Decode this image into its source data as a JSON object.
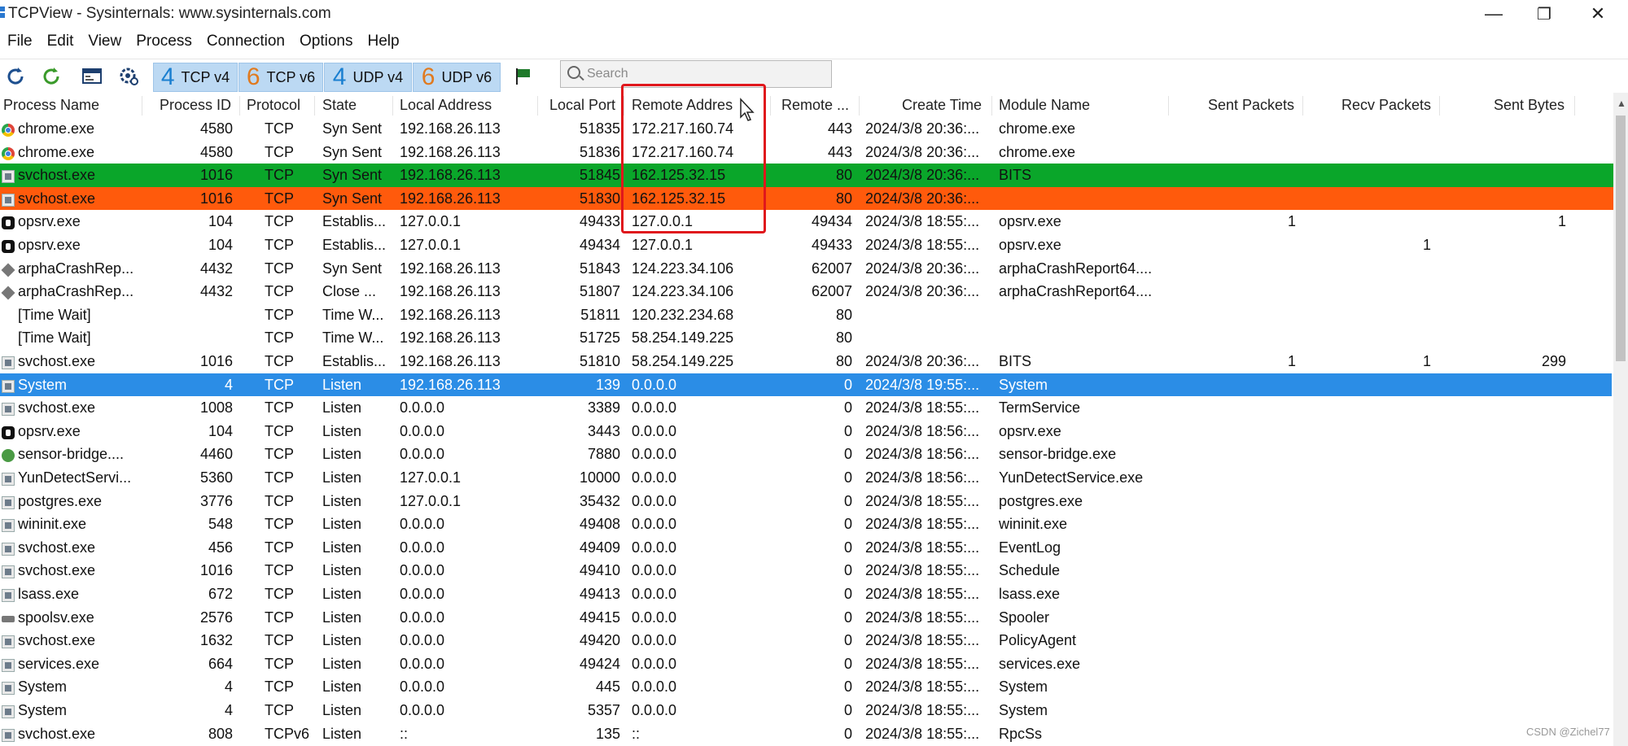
{
  "window": {
    "title": "TCPView - Sysinternals: www.sysinternals.com",
    "minimize_glyph": "—",
    "maximize_glyph": "❐",
    "close_glyph": "✕"
  },
  "menu": [
    "File",
    "Edit",
    "View",
    "Process",
    "Connection",
    "Options",
    "Help"
  ],
  "toolbar": {
    "refresh_icon": "refresh-icon",
    "auto_refresh_icon": "auto-refresh-icon",
    "protocols": [
      {
        "digit": "4",
        "label": "TCP v4"
      },
      {
        "digit": "6",
        "label": "TCP v6"
      },
      {
        "digit": "4",
        "label": "UDP v4"
      },
      {
        "digit": "6",
        "label": "UDP v6"
      }
    ],
    "search_placeholder": "Search"
  },
  "columns": [
    "Process Name",
    "Process ID",
    "Protocol",
    "State",
    "Local Address",
    "Local Port",
    "Remote Addres",
    "Remote ...",
    "Create Time",
    "Module Name",
    "Sent Packets",
    "Recv Packets",
    "Sent Bytes"
  ],
  "rows": [
    {
      "icon": "chrome",
      "name": "chrome.exe",
      "pid": "4580",
      "proto": "TCP",
      "state": "Syn Sent",
      "laddr": "192.168.26.113",
      "lport": "51835",
      "raddr": "172.217.160.74",
      "rport": "443",
      "ctime": "2024/3/8 20:36:...",
      "module": "chrome.exe",
      "sp": "",
      "rp": "",
      "sb": "",
      "style": ""
    },
    {
      "icon": "chrome",
      "name": "chrome.exe",
      "pid": "4580",
      "proto": "TCP",
      "state": "Syn Sent",
      "laddr": "192.168.26.113",
      "lport": "51836",
      "raddr": "172.217.160.74",
      "rport": "443",
      "ctime": "2024/3/8 20:36:...",
      "module": "chrome.exe",
      "sp": "",
      "rp": "",
      "sb": "",
      "style": ""
    },
    {
      "icon": "svc",
      "name": "svchost.exe",
      "pid": "1016",
      "proto": "TCP",
      "state": "Syn Sent",
      "laddr": "192.168.26.113",
      "lport": "51845",
      "raddr": "162.125.32.15",
      "rport": "80",
      "ctime": "2024/3/8 20:36:...",
      "module": "BITS",
      "sp": "",
      "rp": "",
      "sb": "",
      "style": "green"
    },
    {
      "icon": "svc",
      "name": "svchost.exe",
      "pid": "1016",
      "proto": "TCP",
      "state": "Syn Sent",
      "laddr": "192.168.26.113",
      "lport": "51830",
      "raddr": "162.125.32.15",
      "rport": "80",
      "ctime": "2024/3/8 20:36:...",
      "module": "",
      "sp": "",
      "rp": "",
      "sb": "",
      "style": "orange"
    },
    {
      "icon": "black",
      "name": "opsrv.exe",
      "pid": "104",
      "proto": "TCP",
      "state": "Establis...",
      "laddr": "127.0.0.1",
      "lport": "49433",
      "raddr": "127.0.0.1",
      "rport": "49434",
      "ctime": "2024/3/8 18:55:...",
      "module": "opsrv.exe",
      "sp": "1",
      "rp": "",
      "sb": "1",
      "style": ""
    },
    {
      "icon": "black",
      "name": "opsrv.exe",
      "pid": "104",
      "proto": "TCP",
      "state": "Establis...",
      "laddr": "127.0.0.1",
      "lport": "49434",
      "raddr": "127.0.0.1",
      "rport": "49433",
      "ctime": "2024/3/8 18:55:...",
      "module": "opsrv.exe",
      "sp": "",
      "rp": "1",
      "sb": "",
      "style": ""
    },
    {
      "icon": "arpha",
      "name": "arphaCrashRep...",
      "pid": "4432",
      "proto": "TCP",
      "state": "Syn Sent",
      "laddr": "192.168.26.113",
      "lport": "51843",
      "raddr": "124.223.34.106",
      "rport": "62007",
      "ctime": "2024/3/8 20:36:...",
      "module": "arphaCrashReport64....",
      "sp": "",
      "rp": "",
      "sb": "",
      "style": ""
    },
    {
      "icon": "arpha",
      "name": "arphaCrashRep...",
      "pid": "4432",
      "proto": "TCP",
      "state": "Close ...",
      "laddr": "192.168.26.113",
      "lport": "51807",
      "raddr": "124.223.34.106",
      "rport": "62007",
      "ctime": "2024/3/8 20:36:...",
      "module": "arphaCrashReport64....",
      "sp": "",
      "rp": "",
      "sb": "",
      "style": ""
    },
    {
      "icon": "none",
      "name": "[Time Wait]",
      "pid": "",
      "proto": "TCP",
      "state": "Time W...",
      "laddr": "192.168.26.113",
      "lport": "51811",
      "raddr": "120.232.234.68",
      "rport": "80",
      "ctime": "",
      "module": "",
      "sp": "",
      "rp": "",
      "sb": "",
      "style": ""
    },
    {
      "icon": "none",
      "name": "[Time Wait]",
      "pid": "",
      "proto": "TCP",
      "state": "Time W...",
      "laddr": "192.168.26.113",
      "lport": "51725",
      "raddr": "58.254.149.225",
      "rport": "80",
      "ctime": "",
      "module": "",
      "sp": "",
      "rp": "",
      "sb": "",
      "style": ""
    },
    {
      "icon": "svc",
      "name": "svchost.exe",
      "pid": "1016",
      "proto": "TCP",
      "state": "Establis...",
      "laddr": "192.168.26.113",
      "lport": "51810",
      "raddr": "58.254.149.225",
      "rport": "80",
      "ctime": "2024/3/8 20:36:...",
      "module": "BITS",
      "sp": "1",
      "rp": "1",
      "sb": "299",
      "style": ""
    },
    {
      "icon": "svc",
      "name": "System",
      "pid": "4",
      "proto": "TCP",
      "state": "Listen",
      "laddr": "192.168.26.113",
      "lport": "139",
      "raddr": "0.0.0.0",
      "rport": "0",
      "ctime": "2024/3/8 19:55:...",
      "module": "System",
      "sp": "",
      "rp": "",
      "sb": "",
      "style": "selected"
    },
    {
      "icon": "svc",
      "name": "svchost.exe",
      "pid": "1008",
      "proto": "TCP",
      "state": "Listen",
      "laddr": "0.0.0.0",
      "lport": "3389",
      "raddr": "0.0.0.0",
      "rport": "0",
      "ctime": "2024/3/8 18:55:...",
      "module": "TermService",
      "sp": "",
      "rp": "",
      "sb": "",
      "style": ""
    },
    {
      "icon": "black",
      "name": "opsrv.exe",
      "pid": "104",
      "proto": "TCP",
      "state": "Listen",
      "laddr": "0.0.0.0",
      "lport": "3443",
      "raddr": "0.0.0.0",
      "rport": "0",
      "ctime": "2024/3/8 18:56:...",
      "module": "opsrv.exe",
      "sp": "",
      "rp": "",
      "sb": "",
      "style": ""
    },
    {
      "icon": "green",
      "name": "sensor-bridge....",
      "pid": "4460",
      "proto": "TCP",
      "state": "Listen",
      "laddr": "0.0.0.0",
      "lport": "7880",
      "raddr": "0.0.0.0",
      "rport": "0",
      "ctime": "2024/3/8 18:56:...",
      "module": "sensor-bridge.exe",
      "sp": "",
      "rp": "",
      "sb": "",
      "style": ""
    },
    {
      "icon": "svc",
      "name": "YunDetectServi...",
      "pid": "5360",
      "proto": "TCP",
      "state": "Listen",
      "laddr": "127.0.0.1",
      "lport": "10000",
      "raddr": "0.0.0.0",
      "rport": "0",
      "ctime": "2024/3/8 18:56:...",
      "module": "YunDetectService.exe",
      "sp": "",
      "rp": "",
      "sb": "",
      "style": ""
    },
    {
      "icon": "svc",
      "name": "postgres.exe",
      "pid": "3776",
      "proto": "TCP",
      "state": "Listen",
      "laddr": "127.0.0.1",
      "lport": "35432",
      "raddr": "0.0.0.0",
      "rport": "0",
      "ctime": "2024/3/8 18:55:...",
      "module": "postgres.exe",
      "sp": "",
      "rp": "",
      "sb": "",
      "style": ""
    },
    {
      "icon": "svc",
      "name": "wininit.exe",
      "pid": "548",
      "proto": "TCP",
      "state": "Listen",
      "laddr": "0.0.0.0",
      "lport": "49408",
      "raddr": "0.0.0.0",
      "rport": "0",
      "ctime": "2024/3/8 18:55:...",
      "module": "wininit.exe",
      "sp": "",
      "rp": "",
      "sb": "",
      "style": ""
    },
    {
      "icon": "svc",
      "name": "svchost.exe",
      "pid": "456",
      "proto": "TCP",
      "state": "Listen",
      "laddr": "0.0.0.0",
      "lport": "49409",
      "raddr": "0.0.0.0",
      "rport": "0",
      "ctime": "2024/3/8 18:55:...",
      "module": "EventLog",
      "sp": "",
      "rp": "",
      "sb": "",
      "style": ""
    },
    {
      "icon": "svc",
      "name": "svchost.exe",
      "pid": "1016",
      "proto": "TCP",
      "state": "Listen",
      "laddr": "0.0.0.0",
      "lport": "49410",
      "raddr": "0.0.0.0",
      "rport": "0",
      "ctime": "2024/3/8 18:55:...",
      "module": "Schedule",
      "sp": "",
      "rp": "",
      "sb": "",
      "style": ""
    },
    {
      "icon": "svc",
      "name": "lsass.exe",
      "pid": "672",
      "proto": "TCP",
      "state": "Listen",
      "laddr": "0.0.0.0",
      "lport": "49413",
      "raddr": "0.0.0.0",
      "rport": "0",
      "ctime": "2024/3/8 18:55:...",
      "module": "lsass.exe",
      "sp": "",
      "rp": "",
      "sb": "",
      "style": ""
    },
    {
      "icon": "spool",
      "name": "spoolsv.exe",
      "pid": "2576",
      "proto": "TCP",
      "state": "Listen",
      "laddr": "0.0.0.0",
      "lport": "49415",
      "raddr": "0.0.0.0",
      "rport": "0",
      "ctime": "2024/3/8 18:55:...",
      "module": "Spooler",
      "sp": "",
      "rp": "",
      "sb": "",
      "style": ""
    },
    {
      "icon": "svc",
      "name": "svchost.exe",
      "pid": "1632",
      "proto": "TCP",
      "state": "Listen",
      "laddr": "0.0.0.0",
      "lport": "49420",
      "raddr": "0.0.0.0",
      "rport": "0",
      "ctime": "2024/3/8 18:55:...",
      "module": "PolicyAgent",
      "sp": "",
      "rp": "",
      "sb": "",
      "style": ""
    },
    {
      "icon": "svc",
      "name": "services.exe",
      "pid": "664",
      "proto": "TCP",
      "state": "Listen",
      "laddr": "0.0.0.0",
      "lport": "49424",
      "raddr": "0.0.0.0",
      "rport": "0",
      "ctime": "2024/3/8 18:55:...",
      "module": "services.exe",
      "sp": "",
      "rp": "",
      "sb": "",
      "style": ""
    },
    {
      "icon": "svc",
      "name": "System",
      "pid": "4",
      "proto": "TCP",
      "state": "Listen",
      "laddr": "0.0.0.0",
      "lport": "445",
      "raddr": "0.0.0.0",
      "rport": "0",
      "ctime": "2024/3/8 18:55:...",
      "module": "System",
      "sp": "",
      "rp": "",
      "sb": "",
      "style": ""
    },
    {
      "icon": "svc",
      "name": "System",
      "pid": "4",
      "proto": "TCP",
      "state": "Listen",
      "laddr": "0.0.0.0",
      "lport": "5357",
      "raddr": "0.0.0.0",
      "rport": "0",
      "ctime": "2024/3/8 18:55:...",
      "module": "System",
      "sp": "",
      "rp": "",
      "sb": "",
      "style": ""
    },
    {
      "icon": "svc",
      "name": "svchost.exe",
      "pid": "808",
      "proto": "TCPv6",
      "state": "Listen",
      "laddr": "::",
      "lport": "135",
      "raddr": "::",
      "rport": "0",
      "ctime": "2024/3/8 18:55:...",
      "module": "RpcSs",
      "sp": "",
      "rp": "",
      "sb": "",
      "style": ""
    }
  ],
  "colors": {
    "new_connection": "#0aa62a",
    "closing_connection": "#ff5a0c",
    "selected_row": "#2b8de6",
    "annotation": "#e0171c"
  },
  "watermark": "CSDN @Zichel77"
}
